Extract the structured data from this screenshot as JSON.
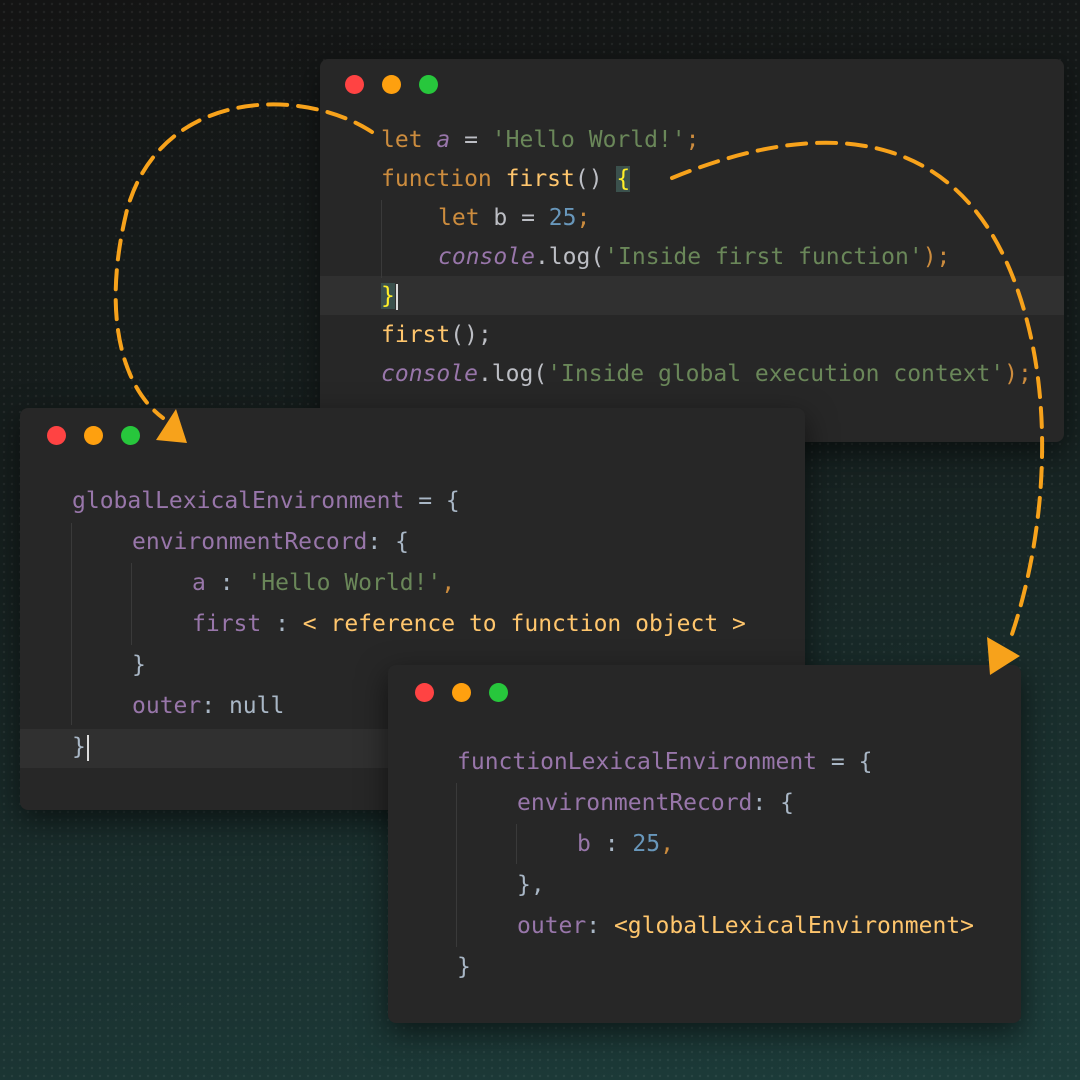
{
  "colors": {
    "accent_arrow": "#f7a21b",
    "window_bg": "#272727",
    "dot_close": "#ff4343",
    "dot_minimize": "#fea00f",
    "dot_maximize": "#27c73c"
  },
  "code_window": {
    "lines": [
      {
        "t1": "let ",
        "t2": "a",
        "t3": " = ",
        "t4": "'Hello World!'",
        "t5": ";"
      },
      {
        "t1": "function ",
        "t2": "first",
        "t3": "() ",
        "t4": "{"
      },
      {
        "t1": "let ",
        "t2": "b",
        "t3": " = ",
        "t4": "25",
        "t5": ";"
      },
      {
        "t1": "console",
        "t2": ".log(",
        "t3": "'Inside first function'",
        "t4": ");"
      },
      {
        "t1": "}"
      },
      {
        "t1": "first",
        "t2": "();"
      },
      {
        "t1": "console",
        "t2": ".log(",
        "t3": "'Inside global execution context'",
        "t4": ");"
      }
    ]
  },
  "global_window": {
    "lines": [
      {
        "t1": "globalLexicalEnvironment",
        "t2": " = {"
      },
      {
        "t1": "environmentRecord",
        "t2": ": {"
      },
      {
        "t1": "a",
        "t2": " : ",
        "t3": "'Hello World!'",
        "t4": ","
      },
      {
        "t1": "first",
        "t2": " : ",
        "t3": "< reference to function object >"
      },
      {
        "t1": "}"
      },
      {
        "t1": "outer",
        "t2": ": ",
        "t3": "null"
      },
      {
        "t1": "}"
      }
    ]
  },
  "function_window": {
    "lines": [
      {
        "t1": "functionLexicalEnvironment",
        "t2": " = {"
      },
      {
        "t1": "environmentRecord",
        "t2": ": {"
      },
      {
        "t1": "b",
        "t2": " : ",
        "t3": "25",
        "t4": ","
      },
      {
        "t1": "},"
      },
      {
        "t1": "outer",
        "t2": ": ",
        "t3": "<globalLexicalEnvironment>"
      },
      {
        "t1": "}"
      }
    ]
  }
}
